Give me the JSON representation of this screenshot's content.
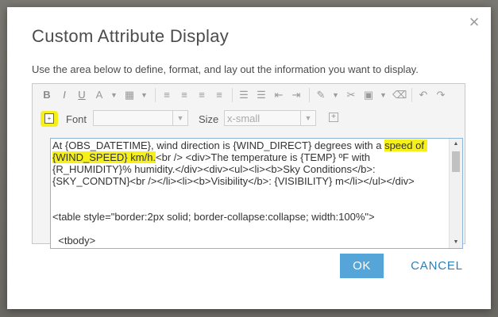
{
  "dialog": {
    "title": "Custom Attribute Display",
    "description": "Use the area below to define, format, and lay out the information you want to display.",
    "close_icon": "close-icon"
  },
  "toolbar": {
    "bold_label": "B",
    "italic_label": "I",
    "underline_label": "U",
    "font_label": "Font",
    "font_value": "",
    "size_label": "Size",
    "size_value": "x-small"
  },
  "editor": {
    "text_before_highlight1": "At {OBS_DATETIME}, wind direction is {WIND_DIRECT} degrees with a ",
    "highlight1": "speed of {WIND_SPEED} km/h.",
    "text_after_highlight1": "<br /> <div>The temperature is {TEMP} ºF with {R_HUMIDITY}% humidity.</div><div><ul><li><b>Sky Conditions</b>: {SKY_CONDTN}<br /></li><li><b>Visibility</b>: {VISIBILITY} m</li></ul></div>",
    "table_line": "<table style=\"border:2px solid; border-collapse:collapse; width:100%\">",
    "tbody_line": "<tbody>"
  },
  "buttons": {
    "ok": "OK",
    "cancel": "CANCEL"
  },
  "colors": {
    "highlight": "#f5f01a",
    "ok_bg": "#56a5d8",
    "cancel_text": "#2d7fb8"
  }
}
